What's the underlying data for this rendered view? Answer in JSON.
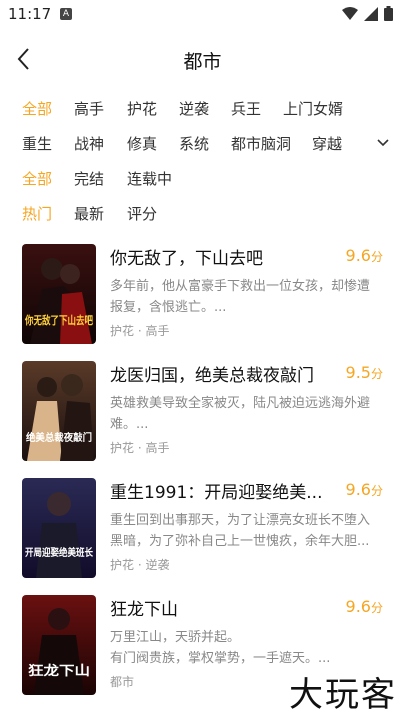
{
  "status_bar": {
    "time": "11:17",
    "notif_letter": "A"
  },
  "header": {
    "title": "都市"
  },
  "filters": {
    "category_row1": [
      "全部",
      "高手",
      "护花",
      "逆袭",
      "兵王",
      "上门女婿"
    ],
    "category_row2": [
      "重生",
      "战神",
      "修真",
      "系统",
      "都市脑洞",
      "穿越"
    ],
    "status": [
      "全部",
      "完结",
      "连载中"
    ],
    "sort": [
      "热门",
      "最新",
      "评分"
    ]
  },
  "books": [
    {
      "title": "你无敌了，下山去吧",
      "score": "9.6",
      "unit": "分",
      "desc": "多年前，他从富豪手下救出一位女孩，却惨遭报复，含恨逃亡。...",
      "tags": "护花 · 高手",
      "cover_text": "你无敌了下山去吧"
    },
    {
      "title": "龙医归国，绝美总裁夜敲门",
      "score": "9.5",
      "unit": "分",
      "desc": "英雄救美导致全家被灭，陆凡被迫远逃海外避难。...",
      "tags": "护花 · 高手",
      "cover_text": "绝美总裁夜敲门"
    },
    {
      "title": "重生1991：开局迎娶绝美...",
      "score": "9.6",
      "unit": "分",
      "desc": "重生回到出事那天，为了让漂亮女班长不堕入黑暗，为了弥补自己上一世愧疚，余年大胆...",
      "tags": "护花 · 逆袭",
      "cover_text": "开局迎娶绝美班长"
    },
    {
      "title": "狂龙下山",
      "score": "9.6",
      "unit": "分",
      "desc": "万里江山，天骄并起。\n有门阀贵族，掌权掌势，一手遮天。...",
      "tags": "都市",
      "cover_text": "狂龙下山"
    }
  ],
  "watermark": "大玩客",
  "colors": {
    "accent": "#f5a623"
  }
}
